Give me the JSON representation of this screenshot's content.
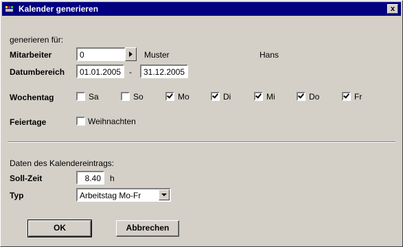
{
  "window": {
    "title": "Kalender generieren",
    "close_label": "x"
  },
  "section1": {
    "heading": "generieren für:"
  },
  "mitarbeiter": {
    "label": "Mitarbeiter",
    "value": "0",
    "lastname": "Muster",
    "firstname": "Hans"
  },
  "datum": {
    "label": "Datumbereich",
    "from": "01.01.2005",
    "separator": "-",
    "to": "31.12.2005"
  },
  "wochentag": {
    "label": "Wochentag",
    "days": [
      {
        "label": "Sa",
        "checked": false
      },
      {
        "label": "So",
        "checked": false
      },
      {
        "label": "Mo",
        "checked": true
      },
      {
        "label": "Di",
        "checked": true
      },
      {
        "label": "Mi",
        "checked": true
      },
      {
        "label": "Do",
        "checked": true
      },
      {
        "label": "Fr",
        "checked": true
      }
    ]
  },
  "feiertage": {
    "label": "Feiertage",
    "option": "Weihnachten",
    "checked": false
  },
  "section2": {
    "heading": "Daten des Kalendereintrags:"
  },
  "sollzeit": {
    "label": "Soll-Zeit",
    "value": "8.40",
    "unit": "h"
  },
  "typ": {
    "label": "Typ",
    "value": "Arbeitstag  Mo-Fr"
  },
  "buttons": {
    "ok": "OK",
    "cancel": "Abbrechen"
  }
}
